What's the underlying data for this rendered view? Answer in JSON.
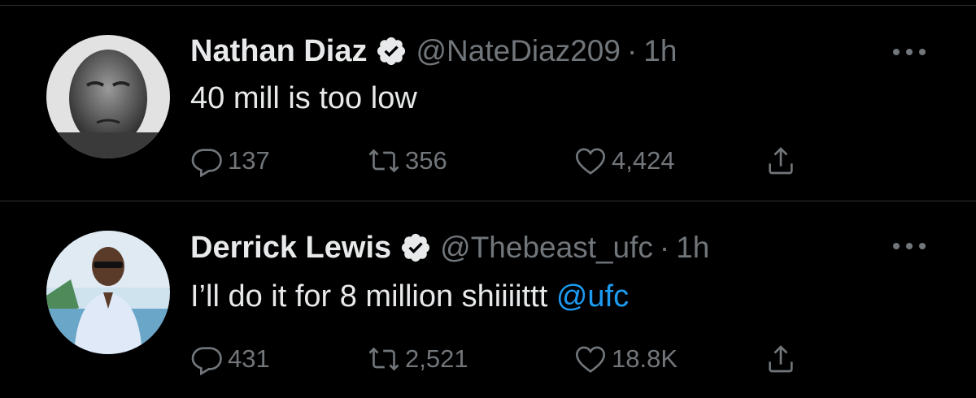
{
  "tweets": [
    {
      "name": "Nathan Diaz",
      "handle": "@NateDiaz209",
      "separator": "·",
      "time": "1h",
      "text": "40 mill is too low",
      "replies": "137",
      "retweets": "356",
      "likes": "4,424"
    },
    {
      "name": "Derrick Lewis",
      "handle": "@Thebeast_ufc",
      "separator": "·",
      "time": "1h",
      "text_prefix": "I’ll do it for 8 million shiiiittt ",
      "mention": "@ufc",
      "replies": "431",
      "retweets": "2,521",
      "likes": "18.8K"
    }
  ],
  "icons": {
    "verified": "verified-badge-icon",
    "more": "more-icon",
    "reply": "reply-icon",
    "retweet": "retweet-icon",
    "like": "like-icon",
    "share": "share-icon"
  },
  "colors": {
    "background": "#000000",
    "text": "#e7e9ea",
    "secondary": "#71767b",
    "link": "#1d9bf0"
  }
}
